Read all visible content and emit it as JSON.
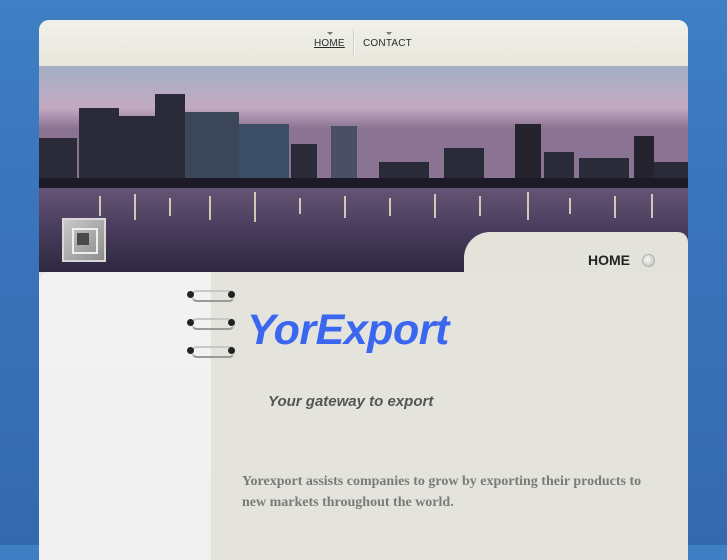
{
  "nav": {
    "items": [
      {
        "label": "HOME"
      },
      {
        "label": "CONTACT"
      }
    ]
  },
  "banner": {
    "section_title": "HOME"
  },
  "site": {
    "brand": "YorExport",
    "tagline": "Your gateway to export",
    "description": "Yorexport assists companies to grow by exporting their products to new markets throughout the world."
  },
  "colors": {
    "background": "#3a74bb",
    "brand_text": "#3a66f0",
    "page": "#e7e7df"
  },
  "icons": {
    "home_bullet": "circle-bullet-icon",
    "logo": "square-logo-icon",
    "rings": "spiral-binding-icon"
  }
}
